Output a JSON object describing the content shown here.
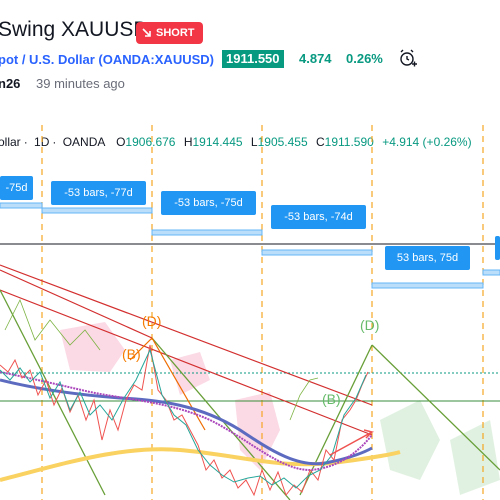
{
  "header": {
    "title": "Swing XAUUSD",
    "idea_badge": "SHORT",
    "symbol_desc": "pot / U.S. Dollar",
    "symbol_code": "OANDA:XAUUSD",
    "last_price": "1911.550",
    "change": "4.874",
    "change_pct": "0.26%",
    "author": "n26",
    "posted": "39 minutes ago"
  },
  "legend": {
    "symbol": "ollar",
    "interval": "1D",
    "exchange": "OANDA",
    "open": "1906.676",
    "high": "1914.445",
    "low": "1905.455",
    "close": "1911.590",
    "change": "+4.914 (+0.26%)"
  },
  "annotations": {
    "bars": [
      "-75d",
      "-53 bars, -77d",
      "-53 bars, -75d",
      "-53 bars, -74d",
      "53 bars, 75d"
    ],
    "waves": [
      "(D)",
      "(B)",
      "(D)",
      "(B)"
    ]
  },
  "colors": {
    "accent": "#2962ff",
    "short": "#f23645",
    "positive": "#089981",
    "label_bg": "#2196f3",
    "cycle_line": "#f5a623",
    "trend_red": "#d32f2f",
    "trend_green": "#689f38"
  }
}
